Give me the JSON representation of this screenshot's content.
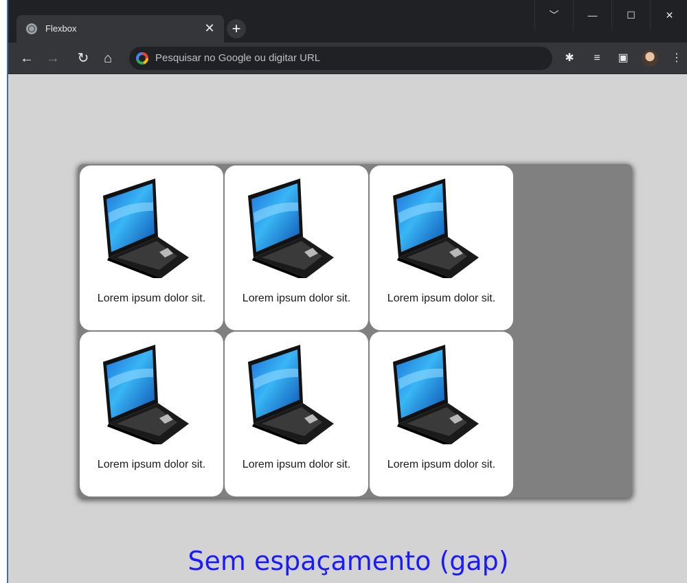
{
  "browser": {
    "tab_title": "Flexbox",
    "tab_close": "✕",
    "new_tab": "+",
    "omnibox_placeholder": "Pesquisar no Google ou digitar URL",
    "window_controls": [
      "﹀",
      "—",
      "☐",
      "✕"
    ]
  },
  "page": {
    "cards": [
      {
        "text": "Lorem ipsum dolor sit."
      },
      {
        "text": "Lorem ipsum dolor sit."
      },
      {
        "text": "Lorem ipsum dolor sit."
      },
      {
        "text": "Lorem ipsum dolor sit."
      },
      {
        "text": "Lorem ipsum dolor sit."
      },
      {
        "text": "Lorem ipsum dolor sit."
      }
    ],
    "caption": "Sem espaçamento (gap)"
  },
  "colors": {
    "page_bg": "#d3d3d3",
    "container_bg": "#808080",
    "caption": "#1a1aff"
  }
}
